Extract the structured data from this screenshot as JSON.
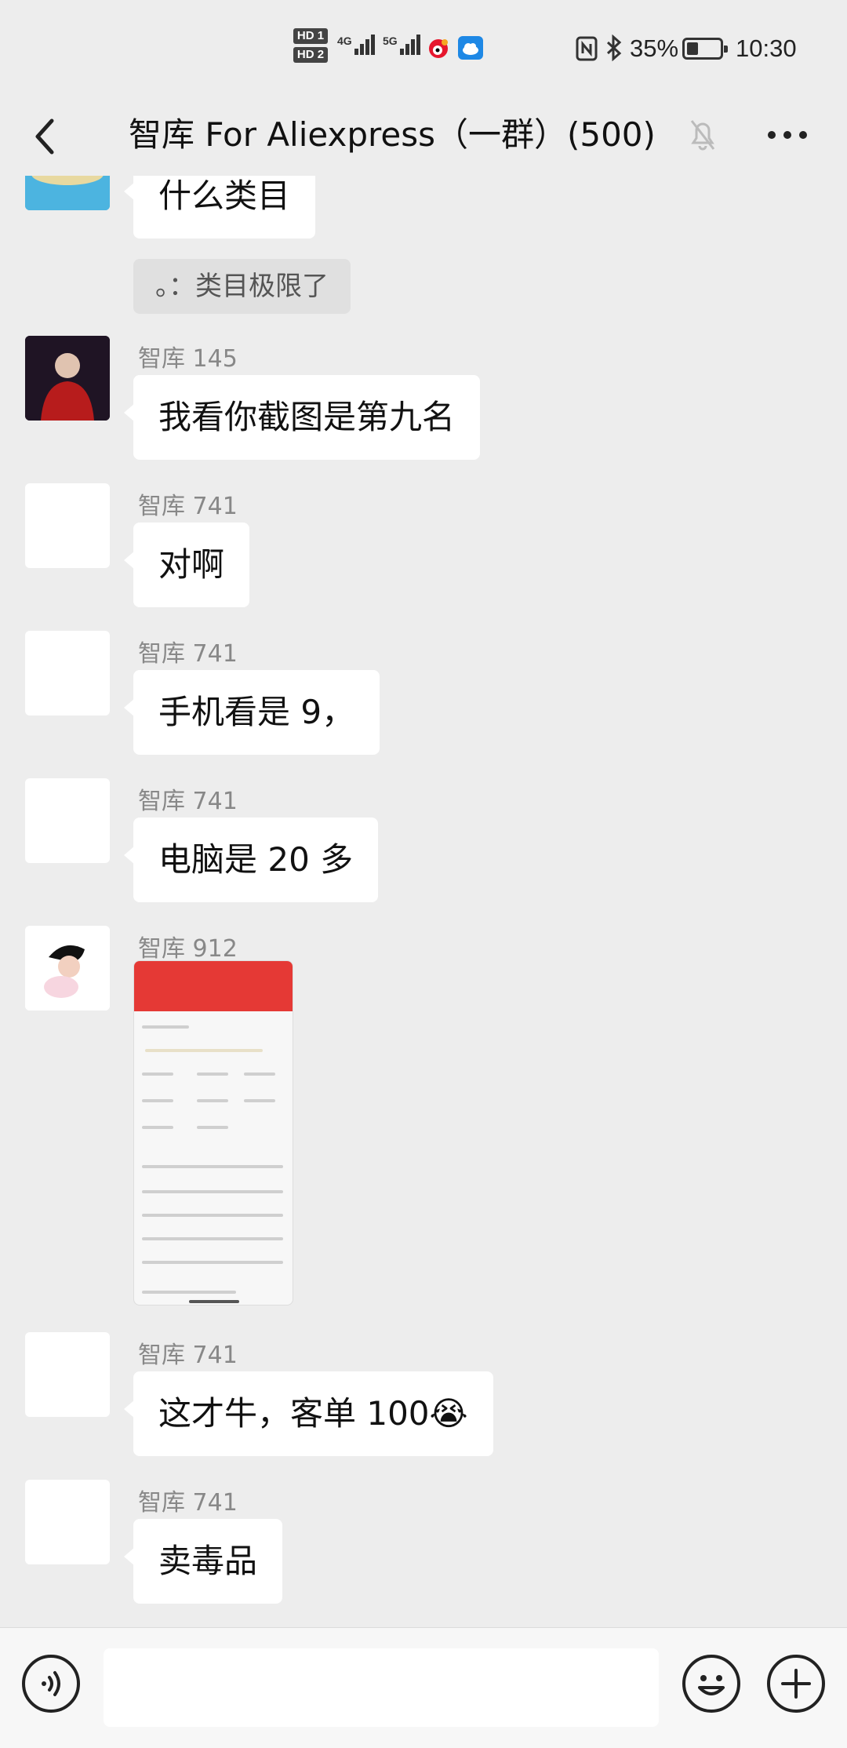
{
  "status_bar": {
    "hd1": "HD 1",
    "hd2": "HD 2",
    "net1": "4G",
    "net2": "5G",
    "battery_percent": "35%",
    "battery_level": 0.35,
    "time": "10:30",
    "icons": [
      "nfc-icon",
      "bluetooth-icon",
      "weibo-icon",
      "cloud-icon"
    ]
  },
  "header": {
    "title": "智库 For Aliexpress（一群）(500)",
    "back_icon": "chevron-left-icon",
    "mute_icon": "bell-off-icon",
    "more_icon": "more-dots-icon"
  },
  "messages": [
    {
      "type": "text",
      "sender": "",
      "text": "什么类目"
    },
    {
      "type": "quote",
      "text": "。：类目极限了"
    },
    {
      "type": "text",
      "sender": "智库 145",
      "text": "我看你截图是第九名"
    },
    {
      "type": "text",
      "sender": "智库 741",
      "text": "对啊"
    },
    {
      "type": "text",
      "sender": "智库 741",
      "text": "手机看是 9，"
    },
    {
      "type": "text",
      "sender": "智库 741",
      "text": "电脑是 20 多"
    },
    {
      "type": "image",
      "sender": "智库 912"
    },
    {
      "type": "text",
      "sender": "智库 741",
      "text": "这才牛，客单 100😭"
    },
    {
      "type": "text",
      "sender": "智库 741",
      "text": "卖毒品"
    }
  ],
  "input_bar": {
    "placeholder": "",
    "voice_icon": "voice-icon",
    "emoji_icon": "emoji-icon",
    "plus_icon": "plus-icon"
  },
  "colors": {
    "background": "#ededed",
    "bubble": "#ffffff",
    "sender_text": "#888888",
    "quote_bg": "#e0e0e0",
    "image_header": "#e53935"
  }
}
